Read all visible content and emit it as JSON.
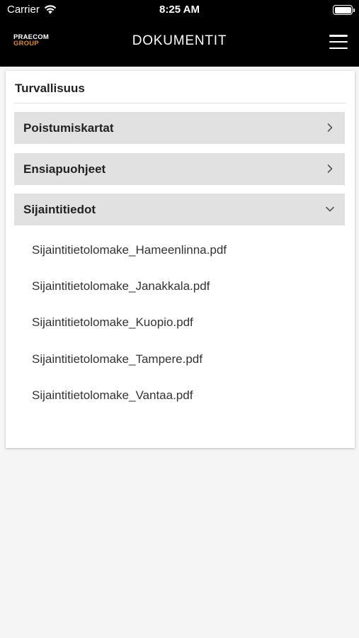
{
  "status_bar": {
    "carrier": "Carrier",
    "time": "8:25 AM"
  },
  "header": {
    "logo_top": "PRAECOM",
    "logo_bottom": "GROUP",
    "title": "DOKUMENTIT",
    "menu_icon": "hamburger-menu-icon"
  },
  "colors": {
    "header_bg": "#000000",
    "logo_accent": "#e08a1e",
    "accordion_bg": "#e1e1e1",
    "page_bg": "#f5f5f5"
  },
  "section": {
    "title": "Turvallisuus",
    "categories": [
      {
        "label": "Poistumiskartat",
        "state": "collapsed",
        "icon": "chevron-right-icon"
      },
      {
        "label": "Ensiapuohjeet",
        "state": "collapsed",
        "icon": "chevron-right-icon"
      },
      {
        "label": "Sijaintitiedot",
        "state": "expanded",
        "icon": "chevron-down-icon"
      }
    ],
    "files": [
      "Sijaintitietolomake_Hameenlinna.pdf",
      "Sijaintitietolomake_Janakkala.pdf",
      "Sijaintitietolomake_Kuopio.pdf",
      "Sijaintitietolomake_Tampere.pdf",
      "Sijaintitietolomake_Vantaa.pdf"
    ]
  }
}
